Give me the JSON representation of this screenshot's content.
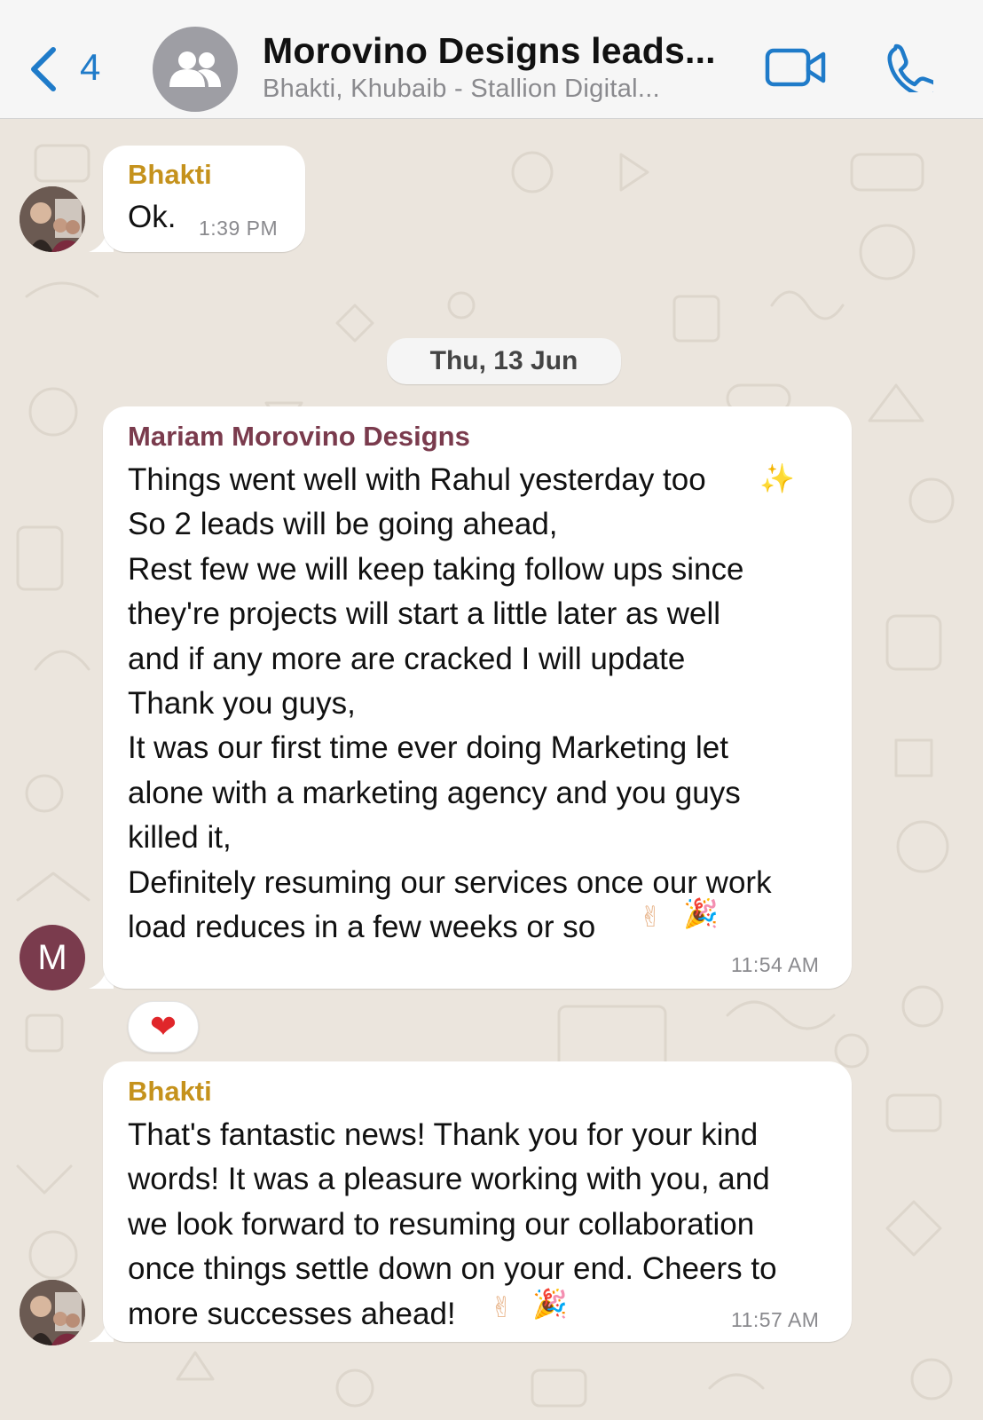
{
  "header": {
    "back_count": "4",
    "title": "Morovino Designs leads...",
    "subtitle": "Bhakti, Khubaib - Stallion Digital...",
    "accent_color": "#1f7bc9"
  },
  "messages": [
    {
      "sender": "Bhakti",
      "text": "Ok.",
      "time": "1:39 PM"
    },
    {
      "sender": "Mariam Morovino Designs",
      "text": "Things went well with Rahul yesterday too\nSo 2 leads will be going ahead,\nRest few we will keep taking follow ups since\nthey're projects will start a little later as well\nand if any more are cracked I will update\nThank you guys,\nIt was our first time ever doing Marketing let\nalone with a marketing agency and you guys\nkilled it,\nDefinitely resuming our services once our work\nload reduces in a few weeks or so",
      "emoji_sparkles": "✨",
      "emoji_peace": "✌",
      "emoji_party": "🎉",
      "time": "11:54 AM",
      "avatar_letter": "M",
      "reaction": "❤"
    },
    {
      "sender": "Bhakti",
      "text": "That's fantastic news! Thank you for your kind\nwords! It was a pleasure working with you, and\nwe look forward to resuming our collaboration\nonce things settle down on your end. Cheers to\nmore successes ahead!",
      "emoji_peace": "✌",
      "emoji_party": "🎉",
      "time": "11:57 AM"
    }
  ],
  "date_separator": "Thu, 13 Jun",
  "colors": {
    "bhakti_name": "#c5921c",
    "mariam_name": "#7a3b4d",
    "reaction_heart": "#e0262a"
  }
}
